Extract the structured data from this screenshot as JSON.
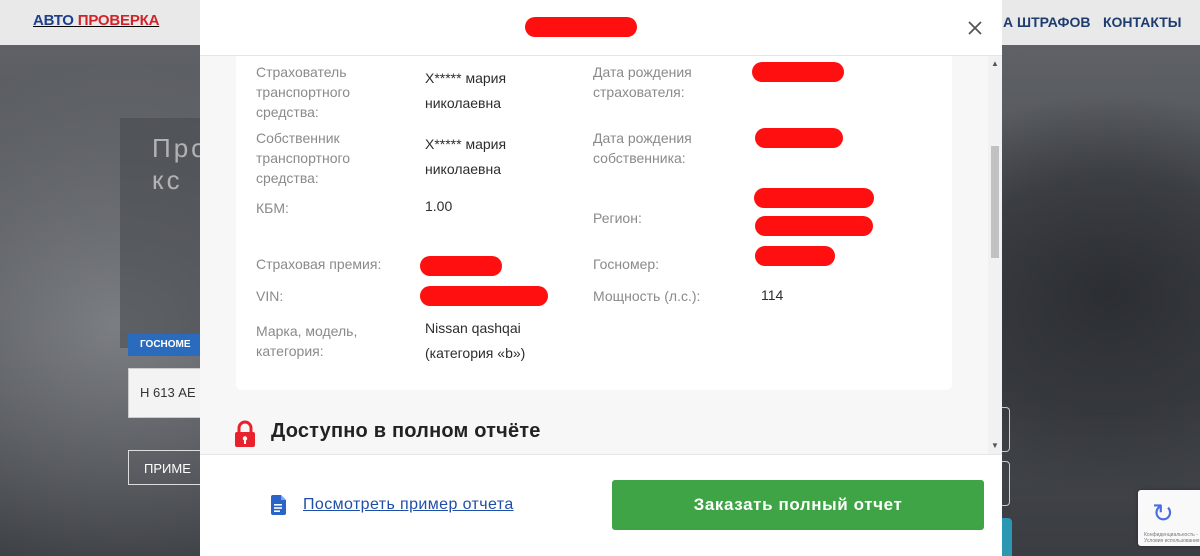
{
  "background": {
    "logo": {
      "part1": "АВТО",
      "part2": "ПРОВЕРКА"
    },
    "nav": [
      "А ШТРАФОВ",
      "КОНТАКТЫ"
    ],
    "hero_title": "Про\nкс",
    "plate_label": "ГОСНОМЕ",
    "plate_value": "Н 613 АЕ",
    "example_button": "ПРИМЕ",
    "recaptcha_text": "Конфиденциальность - Условия использования"
  },
  "modal": {
    "title_redacted": true,
    "rows": [
      {
        "label": "Страхователь\nтранспортного\nсредства:",
        "value": "Х***** мария\nниколаевна"
      },
      {
        "label": "Собственник\nтранспортного\nсредства:",
        "value": "Х***** мария\nниколаевна"
      },
      {
        "label": "КБМ:",
        "value": "1.00"
      },
      {
        "label": "Страховая премия:",
        "value": ""
      },
      {
        "label": "VIN:",
        "value": ""
      },
      {
        "label": "Марка, модель,\nкатегория:",
        "value": "Nissan qashqai\n(категория «b»)"
      }
    ],
    "right_rows": [
      {
        "label": "Дата рождения\nстрахователя:",
        "value": ""
      },
      {
        "label": "Дата рождения\nсобственника:",
        "value": ""
      },
      {
        "label": "Регион:",
        "value": ""
      },
      {
        "label": "Госномер:",
        "value": ""
      },
      {
        "label": "Мощность (л.с.):",
        "value": "114"
      }
    ],
    "full_report_title": "Доступно в полном отчёте",
    "example_link": "Посмотреть пример отчета",
    "order_button": "Заказать полный отчет"
  },
  "colors": {
    "accent_green": "#3fa446",
    "link_blue": "#1f4ea8",
    "redaction_red": "#ff0f0f",
    "lock_red": "#e8212d"
  }
}
